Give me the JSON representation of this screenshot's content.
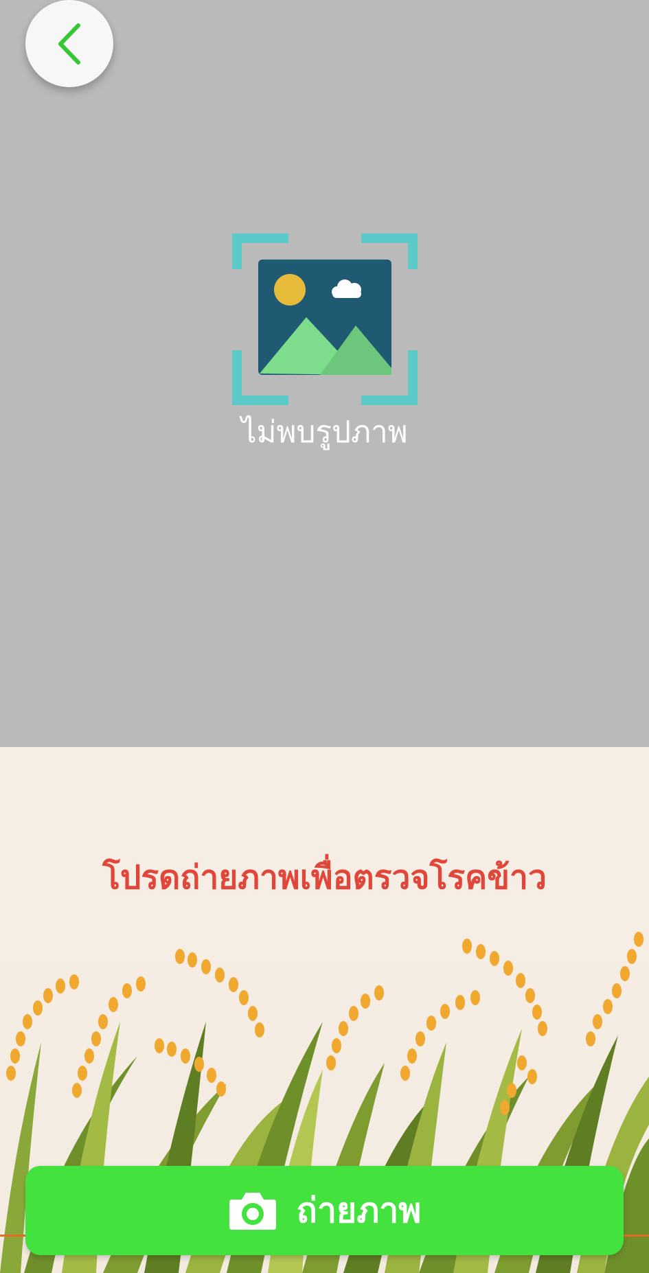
{
  "preview": {
    "empty_text": "ไม่พบรูปภาพ",
    "empty_icon": "image-placeholder-icon",
    "back_icon": "chevron-left-icon",
    "background_color": "#bababa"
  },
  "prompt": {
    "text": "โปรดถ่ายภาพเพื่อตรวจโรคข้าว",
    "color": "#e0473a"
  },
  "capture_button": {
    "label": "ถ่ายภาพ",
    "icon": "camera-icon",
    "color": "#43e23f"
  }
}
